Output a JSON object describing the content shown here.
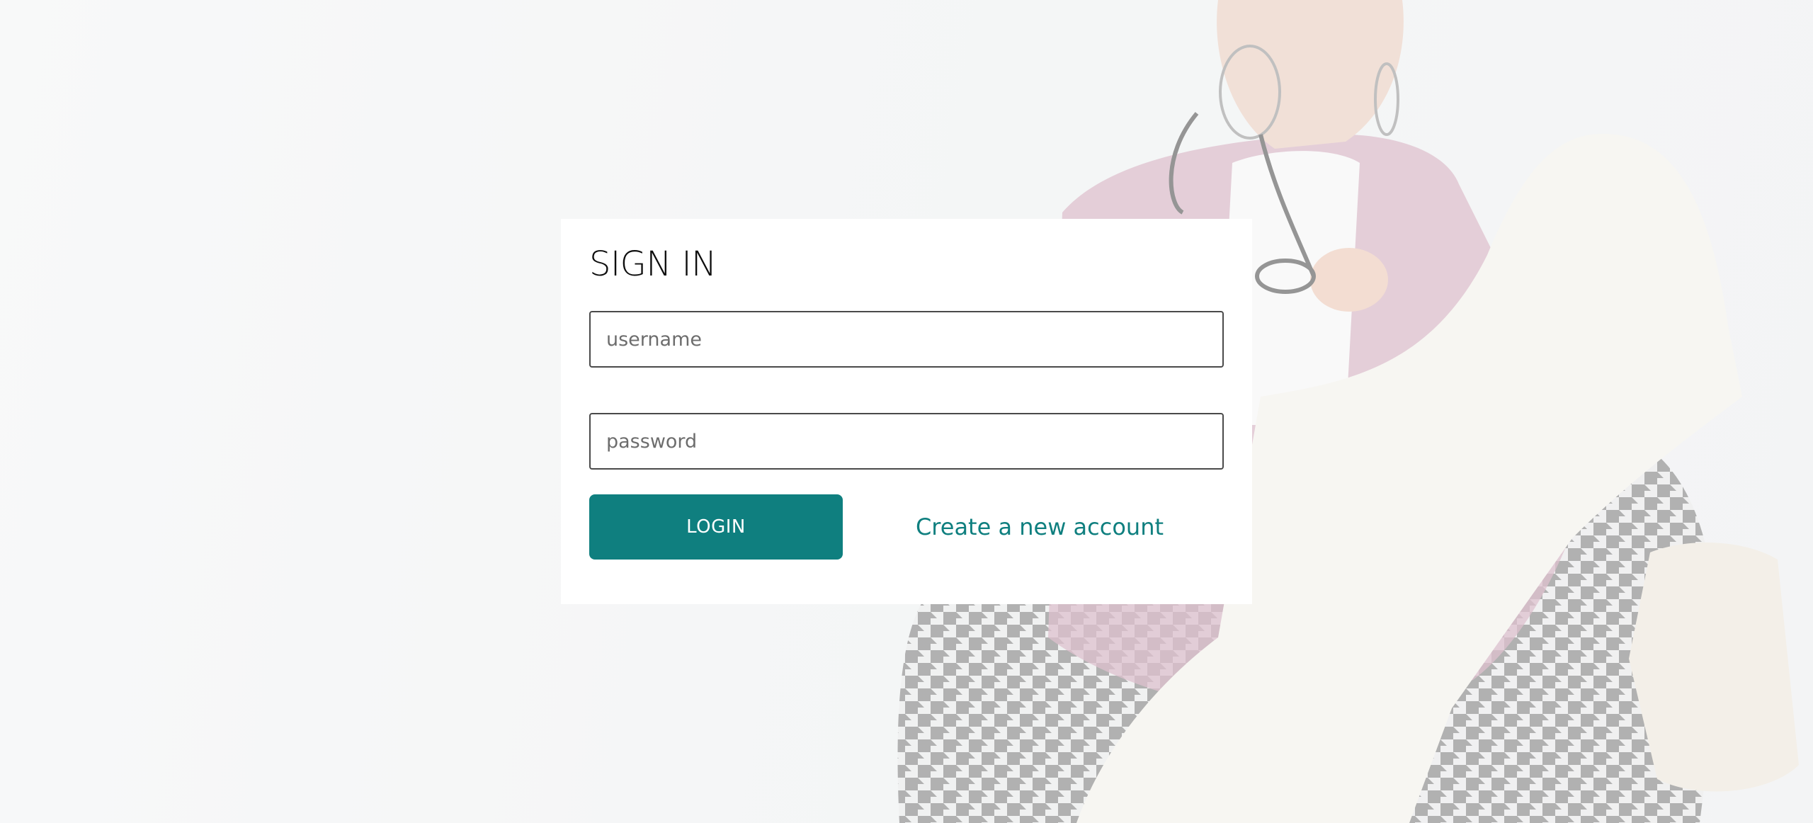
{
  "signin": {
    "title": "SIGN IN",
    "username_placeholder": "username",
    "password_placeholder": "password",
    "login_label": "LOGIN",
    "create_account_label": "Create a new account"
  },
  "colors": {
    "accent": "#0f7f7f",
    "card_background": "#ffffff",
    "field_border": "#4a4a4a"
  }
}
